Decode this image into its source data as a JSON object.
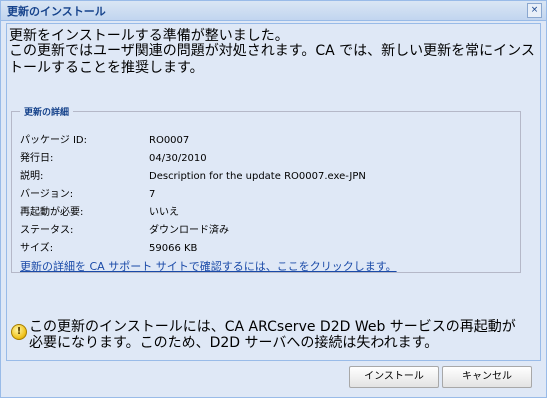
{
  "window": {
    "title": "更新のインストール",
    "close_glyph": "×"
  },
  "intro": {
    "line1": "更新をインストールする準備が整いました。",
    "line2": "この更新ではユーザ関連の問題が対処されます。CA では、新しい更新を常にインストールすることを推奨します。"
  },
  "details": {
    "legend": "更新の詳細",
    "rows": [
      {
        "label": "パッケージ ID:",
        "value": "RO0007"
      },
      {
        "label": "発行日:",
        "value": "04/30/2010"
      },
      {
        "label": "説明:",
        "value": "Description for the update RO0007.exe-JPN"
      },
      {
        "label": "バージョン:",
        "value": "7"
      },
      {
        "label": "再起動が必要:",
        "value": "いいえ"
      },
      {
        "label": "ステータス:",
        "value": "ダウンロード済み"
      },
      {
        "label": "サイズ:",
        "value": "59066 KB"
      }
    ],
    "support_link": "更新の詳細を CA サポート サイトで確認するには、ここをクリックします。"
  },
  "warning": {
    "icon": "warning-icon",
    "glyph": "!",
    "text": "この更新のインストールには、CA ARCserve D2D Web サービスの再起動が必要になります。このため、D2D サーバへの接続は失われます。"
  },
  "buttons": {
    "install": "インストール",
    "cancel": "キャンセル"
  }
}
